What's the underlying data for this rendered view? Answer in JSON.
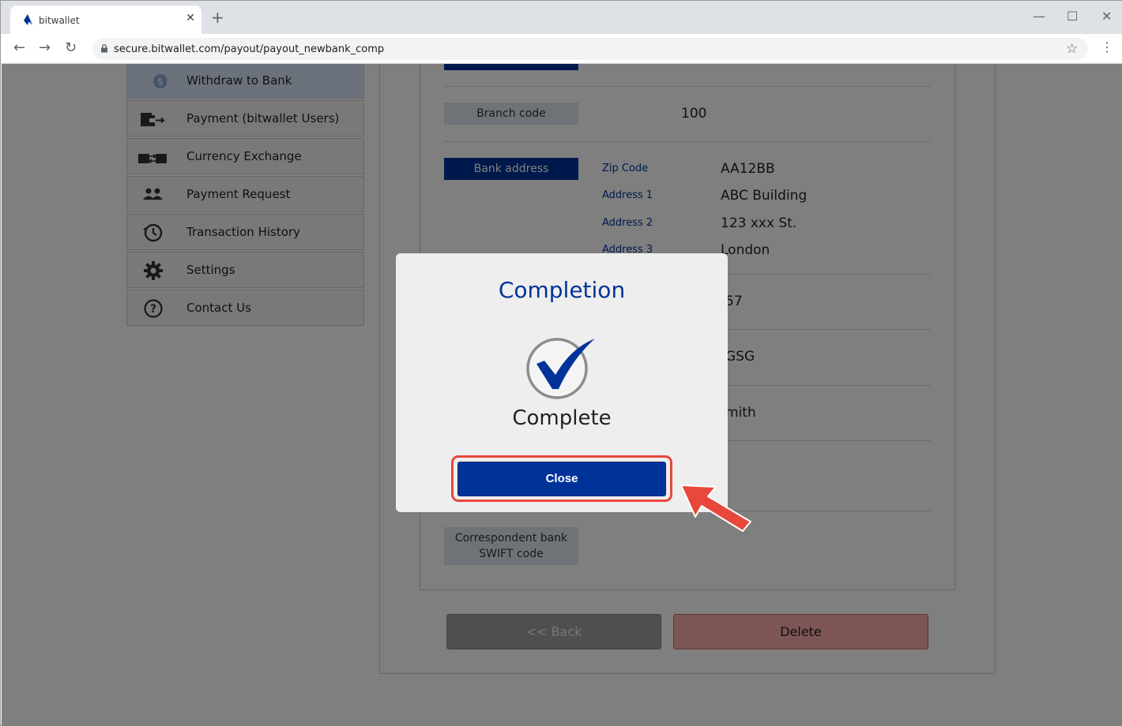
{
  "browser": {
    "tab_title": "bitwallet",
    "url": "secure.bitwallet.com/payout/payout_newbank_comp"
  },
  "sidebar": {
    "items": [
      {
        "label": "Withdraw to Bank",
        "icon": "dollar-coin-icon",
        "active": true
      },
      {
        "label": "Payment (bitwallet Users)",
        "icon": "wallet-send-icon"
      },
      {
        "label": "Currency Exchange",
        "icon": "wallet-exchange-icon"
      },
      {
        "label": "Payment Request",
        "icon": "users-icon"
      },
      {
        "label": "Transaction History",
        "icon": "history-clock-icon"
      },
      {
        "label": "Settings",
        "icon": "gear-icon"
      },
      {
        "label": "Contact Us",
        "icon": "question-circle-icon"
      }
    ]
  },
  "form": {
    "branch_code_label": "Branch code",
    "branch_code_value": "100",
    "bank_address_label": "Bank address",
    "zip_label": "Zip Code",
    "zip_value": "AA12BB",
    "address1_label": "Address 1",
    "address1_value": "ABC Building",
    "address2_label": "Address 2",
    "address2_value": "123 xxx St.",
    "address3_label": "Address 3",
    "address3_value": "London",
    "partial_value_1": "57",
    "partial_value_2": "GSG",
    "partial_value_3": "mith",
    "correspondent_label_line1": "Correspondent bank",
    "correspondent_label_line2": "SWIFT code",
    "back_label": "<< Back",
    "delete_label": "Delete"
  },
  "modal": {
    "title": "Completion",
    "status": "Complete",
    "close_label": "Close"
  },
  "colors": {
    "brand_blue": "#003399",
    "highlight_red": "#e8473c"
  }
}
